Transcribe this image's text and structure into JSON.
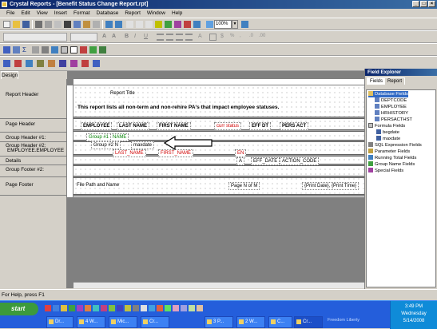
{
  "window": {
    "title": "Crystal Reports - [Benefit Status Change Report.rpt]"
  },
  "menu": [
    "File",
    "Edit",
    "View",
    "Insert",
    "Format",
    "Database",
    "Report",
    "Window",
    "Help"
  ],
  "toolbar": {
    "zoom": "100%"
  },
  "tabs": {
    "design": "Design"
  },
  "sections": [
    "Report Header",
    "Page Header",
    "Group Header #1:",
    "Group Header #2:",
    "EMPLOYEE.EMPLOYEE -",
    "Details",
    "Group Footer #2:",
    "Page Footer"
  ],
  "report": {
    "title_field": "Report Title",
    "header_text": "This report lists all non-term and non-rehire PA's that impact employee statuses.",
    "col_employee": "EMPLOYEE",
    "col_last_name": "LAST NAME",
    "col_first_name": "FIRST NAME",
    "col_curr_status": "curr status",
    "col_eff_dt": "EFF DT",
    "col_pers_act": "PERS ACT",
    "gh1_field1": "Group #1",
    "gh1_field2": "NAME",
    "gh2_field1": "Group #2 N",
    "gh2_field2": "maxdate",
    "det_last_name": "LAST_NAME",
    "det_first_name": "FIRST_NAME",
    "det_flag": "EN",
    "det_eff_date": "EFF_DATE",
    "det_action_code": "ACTION_CODE",
    "det_small": "A",
    "pf_path": "File Path and Name",
    "pf_page": "Page N of M",
    "pf_date": "{Print Date}, {Print Time}"
  },
  "explorer": {
    "title": "Field Explorer",
    "tabs": [
      "Fields",
      "Report"
    ],
    "db_fields": "Database Fields",
    "tables": [
      "DEPTCODE",
      "EMPLOYEE",
      "HRHISTORY",
      "PERSACTHST"
    ],
    "formula_fields": "Formula Fields",
    "formulas": [
      "begdate",
      "maxdate"
    ],
    "others": [
      "SQL Expression Fields",
      "Parameter Fields",
      "Running Total Fields",
      "Group Name Fields",
      "Special Fields"
    ]
  },
  "status": {
    "text": "For Help, press F1"
  },
  "taskbar": {
    "start": "start",
    "tasks": [
      "Dr...",
      "4 W...",
      "Mic...",
      "Cr...",
      "3 P...",
      "2 W...",
      "C...",
      "Cr..."
    ],
    "tray_words": "Freedom  Liberty",
    "time": "3:49 PM",
    "day": "Wednesday",
    "date": "5/14/2008"
  },
  "colors": {
    "title_bar": "#0a246a",
    "taskbar": "#245edb",
    "start": "#3c9a3c",
    "red_field": "#d00000",
    "green_field": "#008000"
  }
}
